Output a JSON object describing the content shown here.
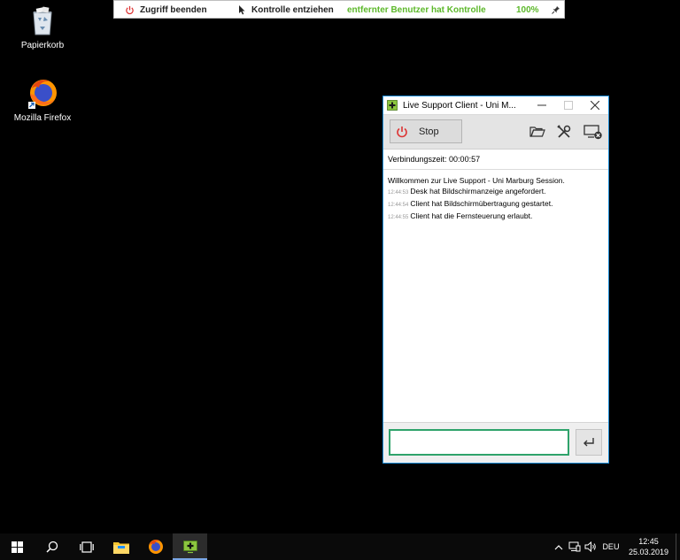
{
  "control_bar": {
    "end_access": "Zugriff beenden",
    "revoke_control": "Kontrolle entziehen",
    "status": "entfernter Benutzer hat Kontrolle",
    "zoom": "100%",
    "status_color": "#5cb82a"
  },
  "desktop": {
    "icons": [
      {
        "label": "Papierkorb",
        "icon": "recycle-bin-icon"
      },
      {
        "label": "Mozilla Firefox",
        "icon": "firefox-icon"
      }
    ]
  },
  "window": {
    "title": "Live Support Client - Uni M...",
    "stop_label": "Stop",
    "connection_time": "Verbindungszeit: 00:00:57",
    "welcome": "Willkommen zur Live Support - Uni Marburg Session.",
    "log": [
      {
        "time": "12:44:53",
        "text": "Desk hat Bildschirmanzeige angefordert."
      },
      {
        "time": "12:44:54",
        "text": "Client hat Bildschirmübertragung gestartet."
      },
      {
        "time": "12:44:55",
        "text": "Client hat die Fernsteuerung erlaubt."
      }
    ],
    "message_value": "",
    "accent_color": "#2fa36b"
  },
  "taskbar": {
    "language": "DEU",
    "time": "12:45",
    "date": "25.03.2019"
  }
}
